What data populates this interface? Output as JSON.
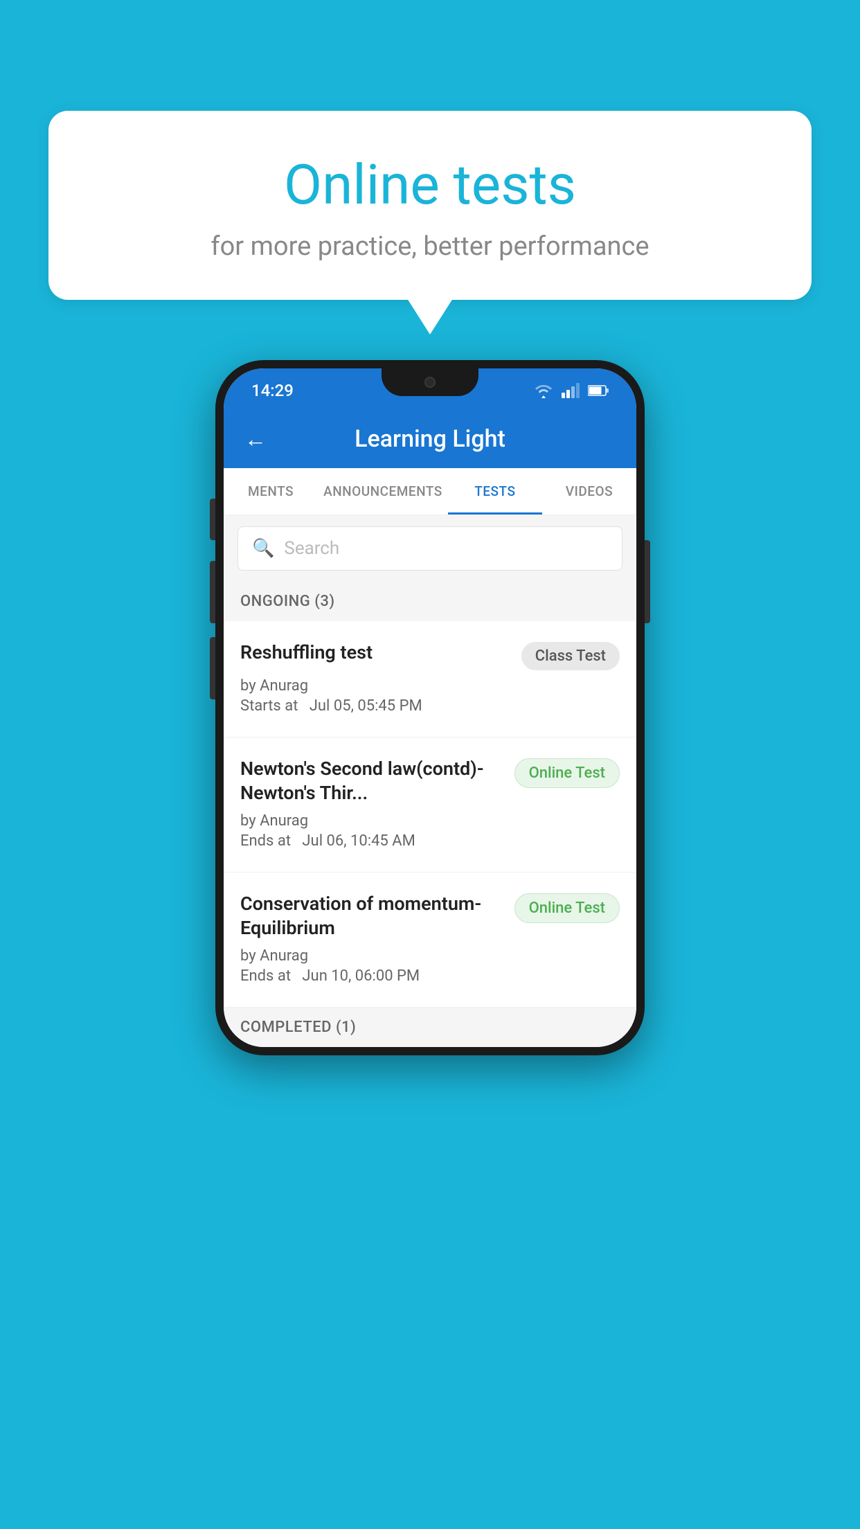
{
  "background_color": "#1ab4d8",
  "bubble": {
    "title": "Online tests",
    "subtitle": "for more practice, better performance"
  },
  "phone": {
    "status_bar": {
      "time": "14:29",
      "icons": [
        "wifi",
        "signal",
        "battery"
      ]
    },
    "app_bar": {
      "title": "Learning Light",
      "back_label": "←"
    },
    "tabs": [
      {
        "label": "MENTS",
        "active": false
      },
      {
        "label": "ANNOUNCEMENTS",
        "active": false
      },
      {
        "label": "TESTS",
        "active": true
      },
      {
        "label": "VIDEOS",
        "active": false
      }
    ],
    "search": {
      "placeholder": "Search"
    },
    "sections": [
      {
        "header": "ONGOING (3)",
        "items": [
          {
            "title": "Reshuffling test",
            "badge": "Class Test",
            "badge_type": "class",
            "by": "by Anurag",
            "time_label": "Starts at",
            "time": "Jul 05, 05:45 PM"
          },
          {
            "title": "Newton's Second law(contd)-Newton's Thir...",
            "badge": "Online Test",
            "badge_type": "online",
            "by": "by Anurag",
            "time_label": "Ends at",
            "time": "Jul 06, 10:45 AM"
          },
          {
            "title": "Conservation of momentum-Equilibrium",
            "badge": "Online Test",
            "badge_type": "online",
            "by": "by Anurag",
            "time_label": "Ends at",
            "time": "Jun 10, 06:00 PM"
          }
        ]
      },
      {
        "header": "COMPLETED (1)",
        "items": []
      }
    ]
  }
}
